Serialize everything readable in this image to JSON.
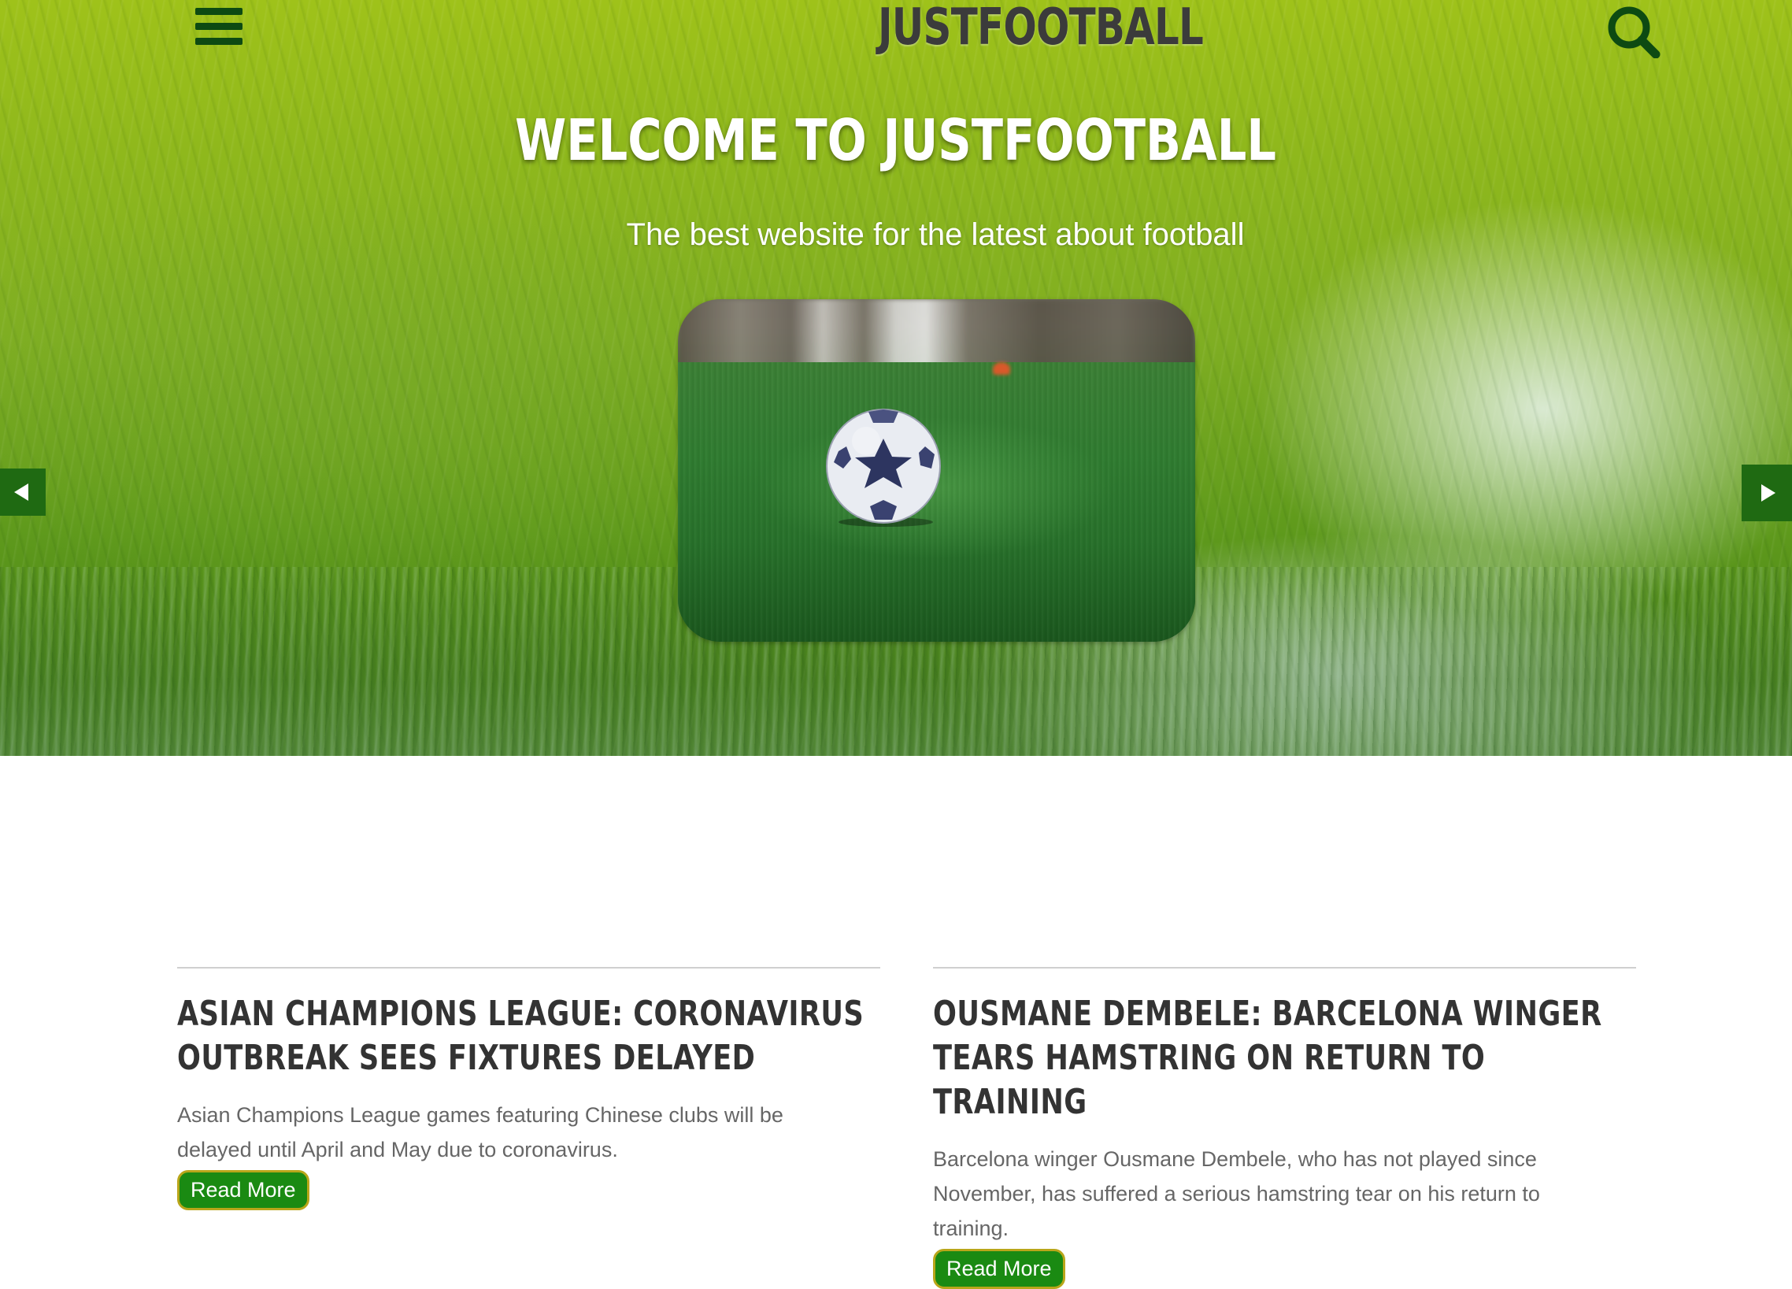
{
  "header": {
    "brand": "JUSTFOOTBALL",
    "menu_icon": "hamburger-menu-icon",
    "search_icon": "search-icon"
  },
  "hero": {
    "welcome": "WELCOME TO JUSTFOOTBALL",
    "tagline": "The best website for the latest about football",
    "prev_icon": "arrow-left-icon",
    "next_icon": "arrow-right-icon"
  },
  "articles": [
    {
      "title": "ASIAN CHAMPIONS LEAGUE: CORONAVIRUS OUTBREAK SEES FIXTURES DELAYED",
      "summary": "Asian Champions League games featuring Chinese clubs will be delayed until April and May due to coronavirus.",
      "button": "Read More"
    },
    {
      "title": "OUSMANE DEMBELE: BARCELONA WINGER TEARS HAMSTRING ON RETURN TO TRAINING",
      "summary": "Barcelona winger Ousmane Dembele, who has not played since November, has suffered a serious hamstring tear on his return to training.",
      "button": "Read More"
    }
  ],
  "colors": {
    "dark_green": "#0d4a12",
    "button_green": "#1a8a12",
    "button_border": "#b9a61a",
    "arrow_bg": "#1f6a12",
    "heading_text": "#333333",
    "body_text": "#666666"
  }
}
